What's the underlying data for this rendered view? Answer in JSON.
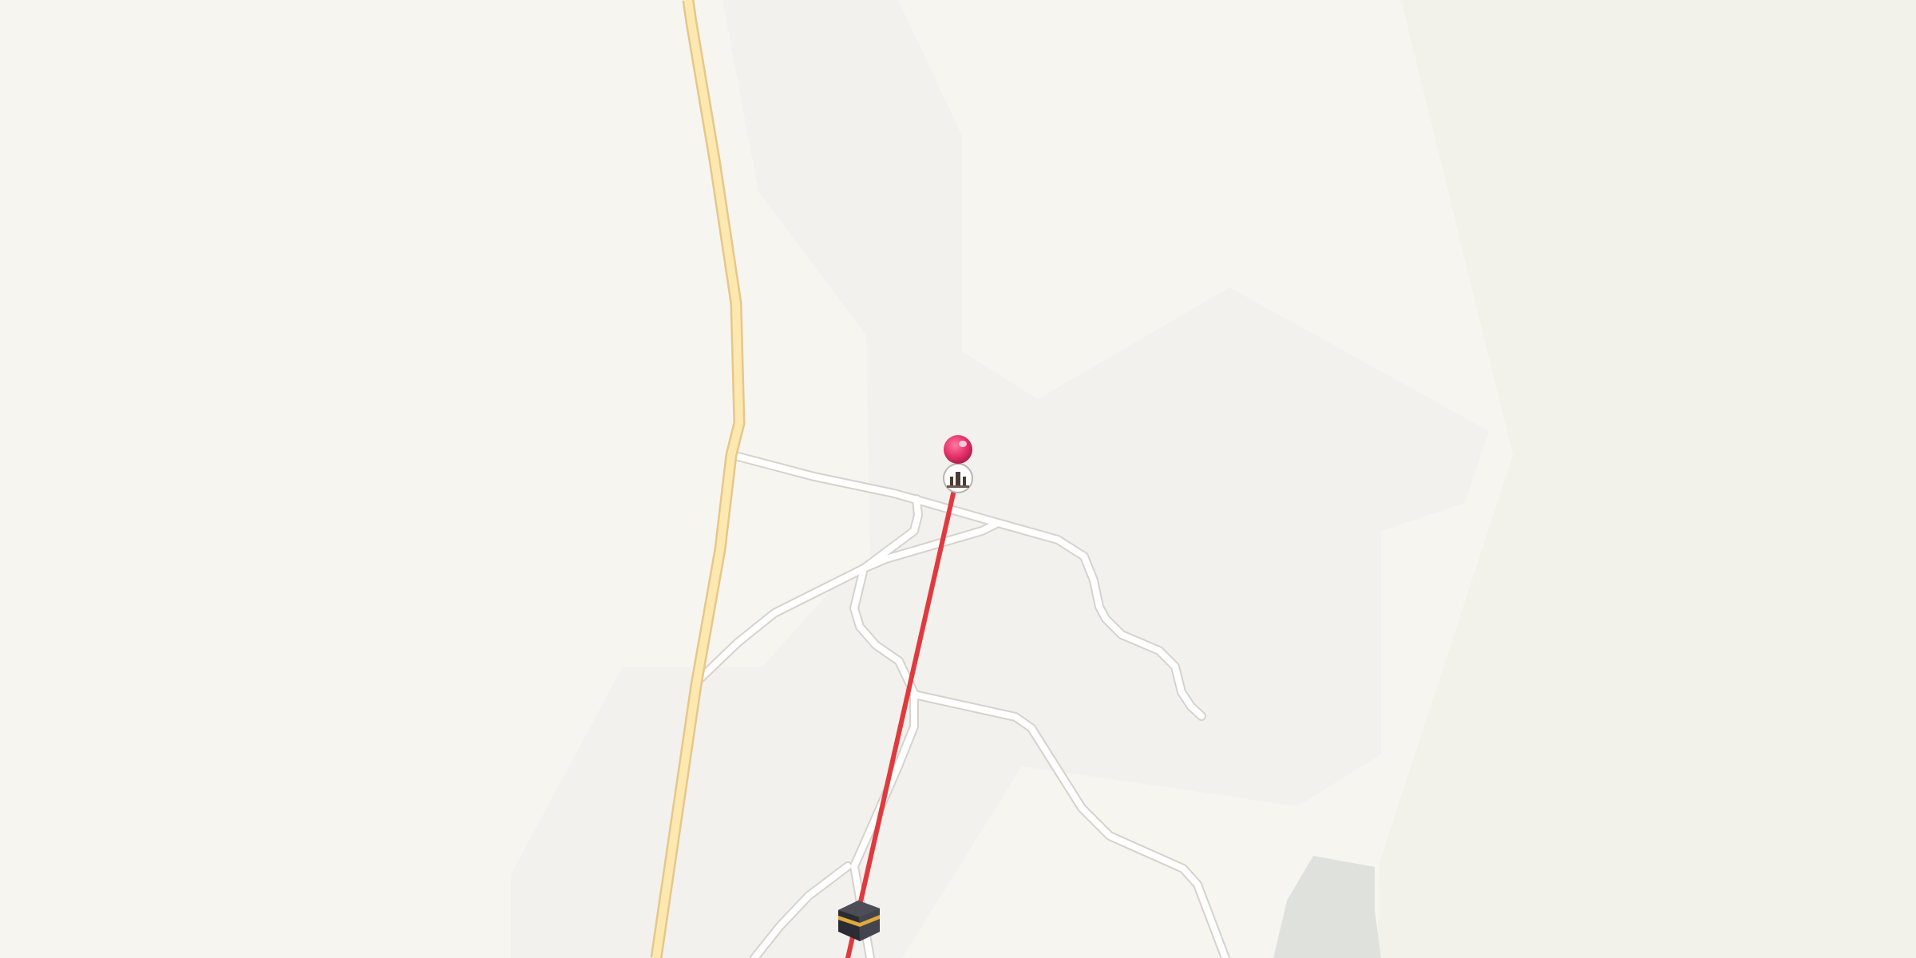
{
  "map": {
    "colors": {
      "background": "#f7f5f0",
      "terrain_light": "#f3f1ed",
      "terrain_green": "#f2f2ea",
      "terrain_dark": "#dfe2dc",
      "major_road_fill": "#fde8b0",
      "major_road_casing": "#e6c78a",
      "minor_road_fill": "#ffffff",
      "minor_road_casing": "#d6d2cb",
      "qibla_line": "#e03a3e",
      "pin": "#e8336b",
      "kaaba_body": "#2b2b33",
      "kaaba_band": "#e0a93b"
    },
    "markers": {
      "location_pin": {
        "icon": "map-pin-icon"
      },
      "mosque": {
        "icon": "mosque-icon"
      },
      "kaaba": {
        "icon": "kaaba-icon"
      }
    },
    "qibla_line": {
      "name": "qibla-direction-line"
    }
  }
}
